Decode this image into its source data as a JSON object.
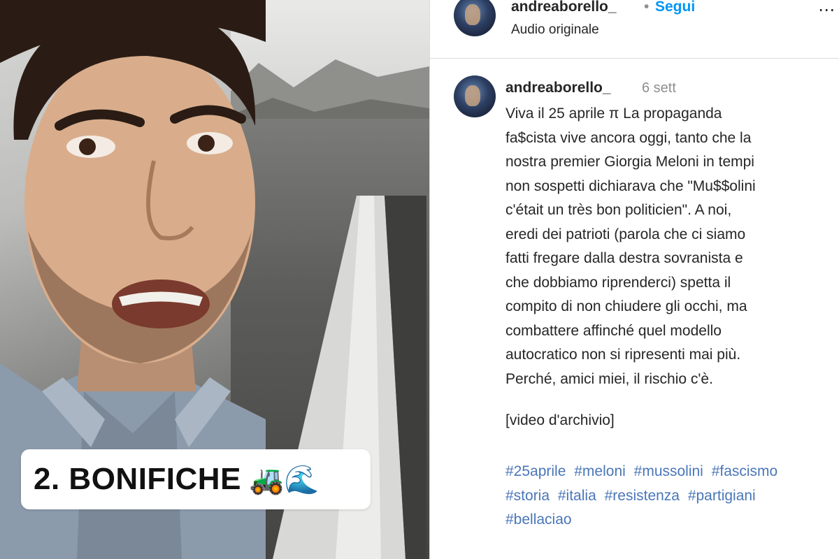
{
  "video": {
    "caption_text": "2. BONIFICHE",
    "caption_emoji": "🚜🌊"
  },
  "header": {
    "username": "andreaborello_",
    "separator": "•",
    "follow_label": "Segui",
    "audio": "Audio originale",
    "more_icon": "more-icon"
  },
  "post": {
    "username": "andreaborello_",
    "time": "6 sett",
    "lines": [
      "Viva il 25 aprile π La propaganda",
      "fa$cista vive ancora oggi, tanto che la",
      "nostra premier Giorgia Meloni in tempi",
      "non sospetti dichiarava che \"Mu$$olini",
      "c'était un très bon politicien\". A noi,",
      "eredi dei patrioti (parola che ci siamo",
      "fatti fregare dalla destra sovranista e",
      "che dobbiamo riprenderci) spetta il",
      "compito di non chiudere gli occhi, ma",
      "combattere affinché quel modello",
      "autocratico non si ripresenti mai più.",
      "Perché, amici miei, il rischio c'è."
    ],
    "archive": "[video d'archivio]",
    "hashtags": [
      [
        "#25aprile",
        "#meloni",
        "#mussolini",
        "#fascismo"
      ],
      [
        "#storia",
        "#italia",
        "#resistenza",
        "#partigiani"
      ],
      [
        "#bellaciao"
      ]
    ]
  },
  "colors": {
    "link": "#4a76b9",
    "follow": "#0095f6",
    "muted": "#8e8e8e",
    "text": "#262626"
  }
}
